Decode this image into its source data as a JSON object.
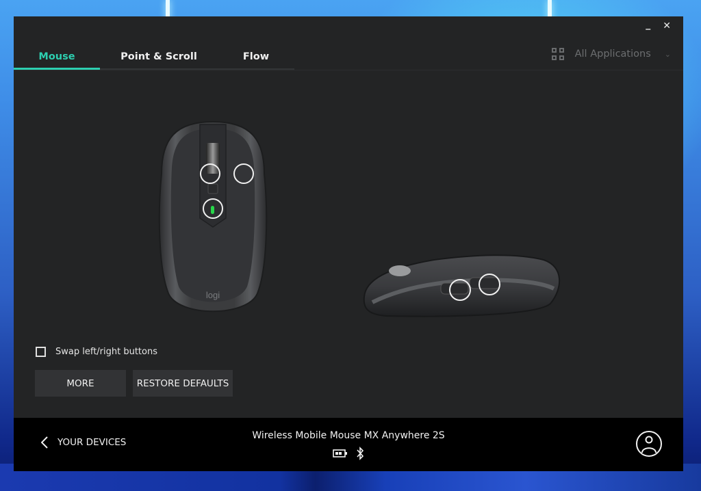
{
  "window": {
    "minimize_label": "_",
    "close_label": "✕"
  },
  "tabs": [
    {
      "label": "Mouse",
      "active": true
    },
    {
      "label": "Point & Scroll",
      "active": false
    },
    {
      "label": "Flow",
      "active": false
    }
  ],
  "app_selector": {
    "icon": "grid-icon",
    "label": "All Applications",
    "dropdown_icon": "⌄"
  },
  "device_view": {
    "top_view_logo": "logi",
    "led_color": "#27d64a",
    "accent_color": "#2dcfb0"
  },
  "options": {
    "swap_label": "Swap left/right buttons",
    "swap_checked": false,
    "more_label": "MORE",
    "restore_label": "RESTORE DEFAULTS"
  },
  "footer": {
    "back_icon": "‹",
    "back_label": "YOUR DEVICES",
    "device_name": "Wireless Mobile Mouse MX Anywhere 2S",
    "battery_icon": "battery-icon",
    "connection_icon": "bluetooth-icon",
    "account_icon": "user-icon"
  }
}
